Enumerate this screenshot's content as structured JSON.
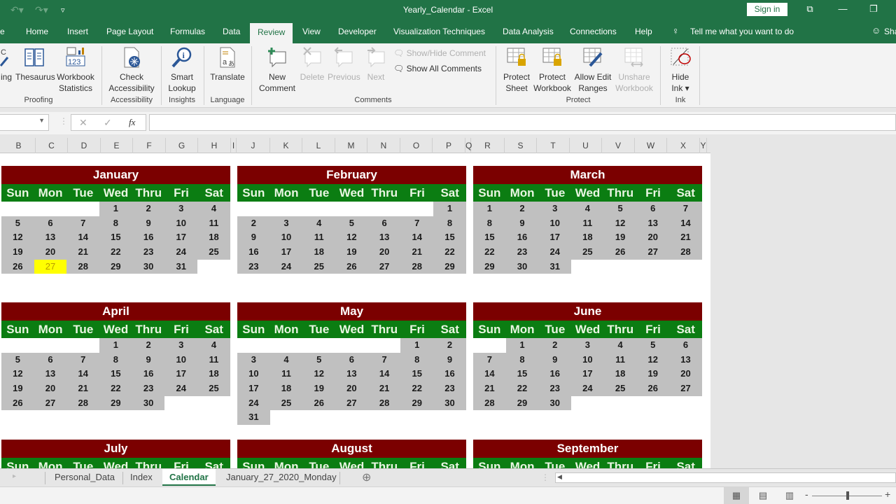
{
  "titlebar": {
    "title": "Yearly_Calendar  -  Excel",
    "sign_in": "Sign in",
    "undo_icon": "undo-icon",
    "redo_icon": "redo-icon",
    "customize_icon": "customize-quick-access-icon"
  },
  "tabs": [
    {
      "label": "e",
      "name": "file"
    },
    {
      "label": "Home"
    },
    {
      "label": "Insert"
    },
    {
      "label": "Page Layout"
    },
    {
      "label": "Formulas"
    },
    {
      "label": "Data"
    },
    {
      "label": "Review",
      "active": true
    },
    {
      "label": "View"
    },
    {
      "label": "Developer"
    },
    {
      "label": "Visualization Techniques"
    },
    {
      "label": "Data Analysis"
    },
    {
      "label": "Connections"
    },
    {
      "label": "Help"
    }
  ],
  "tell_me": "Tell me what you want to do",
  "share": "Sha",
  "ribbon": {
    "proofing": {
      "spelling": "ing",
      "thesaurus": "Thesaurus",
      "workbook_statistics": [
        "Workbook",
        "Statistics"
      ],
      "label": "Proofing"
    },
    "accessibility": {
      "check": [
        "Check",
        "Accessibility"
      ],
      "label": "Accessibility"
    },
    "insights": {
      "smart_lookup": [
        "Smart",
        "Lookup"
      ],
      "label": "Insights"
    },
    "language": {
      "translate": "Translate",
      "label": "Language"
    },
    "comments": {
      "new_comment": [
        "New",
        "Comment"
      ],
      "delete": "Delete",
      "previous": "Previous",
      "next": "Next",
      "show_hide": "Show/Hide Comment",
      "show_all": "Show All Comments",
      "label": "Comments"
    },
    "protect": {
      "protect_sheet": [
        "Protect",
        "Sheet"
      ],
      "protect_workbook": [
        "Protect",
        "Workbook"
      ],
      "allow_edit": [
        "Allow Edit",
        "Ranges"
      ],
      "unshare": [
        "Unshare",
        "Workbook"
      ],
      "label": "Protect"
    },
    "ink": {
      "hide_ink": [
        "Hide",
        "Ink ▾"
      ],
      "label": "Ink"
    }
  },
  "formula_bar": {
    "name_box": "",
    "cancel": "✕",
    "enter": "✓",
    "fx": "fx",
    "value": ""
  },
  "columns": [
    "B",
    "C",
    "D",
    "E",
    "F",
    "G",
    "H",
    "I",
    "J",
    "K",
    "L",
    "M",
    "N",
    "O",
    "P",
    "Q",
    "R",
    "S",
    "T",
    "U",
    "V",
    "W",
    "X",
    "Y"
  ],
  "weekdays": [
    "Sun",
    "Mon",
    "Tue",
    "Wed",
    "Thru",
    "Fri",
    "Sat"
  ],
  "calendar": {
    "today": {
      "month": "January",
      "day": 27
    },
    "months": [
      {
        "name": "January",
        "offset": 3,
        "days": 31
      },
      {
        "name": "February",
        "offset": 6,
        "days": 29
      },
      {
        "name": "March",
        "offset": 0,
        "days": 31
      },
      {
        "name": "April",
        "offset": 3,
        "days": 30
      },
      {
        "name": "May",
        "offset": 5,
        "days": 31
      },
      {
        "name": "June",
        "offset": 1,
        "days": 30
      },
      {
        "name": "July"
      },
      {
        "name": "August"
      },
      {
        "name": "September"
      }
    ]
  },
  "colors": {
    "excel_green": "#217346",
    "month_header": "#7b0000",
    "weekday_header": "#0b7d12",
    "day_fill": "#c0c0c0",
    "today_fill": "#ffff00"
  },
  "sheet_tabs": [
    {
      "label": "Personal_Data"
    },
    {
      "label": "Index"
    },
    {
      "label": "Calendar",
      "active": true
    },
    {
      "label": "January_27_2020_Monday"
    }
  ],
  "status": {
    "zoom_percent": 100
  }
}
